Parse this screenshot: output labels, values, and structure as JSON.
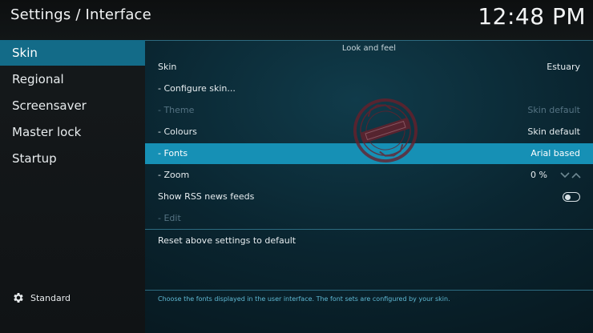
{
  "header": {
    "title": "Settings / Interface",
    "clock": "12:48 PM"
  },
  "sidebar": {
    "items": [
      {
        "label": "Skin",
        "active": true
      },
      {
        "label": "Regional",
        "active": false
      },
      {
        "label": "Screensaver",
        "active": false
      },
      {
        "label": "Master lock",
        "active": false
      },
      {
        "label": "Startup",
        "active": false
      }
    ],
    "level": {
      "icon": "gear-icon",
      "label": "Standard"
    }
  },
  "main": {
    "group_title": "Look and feel",
    "rows": [
      {
        "label": "Skin",
        "value": "Estuary",
        "state": "normal"
      },
      {
        "label": "- Configure skin...",
        "value": "",
        "state": "normal"
      },
      {
        "label": "- Theme",
        "value": "Skin default",
        "state": "disabled"
      },
      {
        "label": "- Colours",
        "value": "Skin default",
        "state": "normal"
      },
      {
        "label": "- Fonts",
        "value": "Arial based",
        "state": "focused"
      },
      {
        "label": "- Zoom",
        "value": "0 %",
        "state": "normal"
      },
      {
        "label": "Show RSS news feeds",
        "value": "",
        "state": "normal",
        "toggle": false
      },
      {
        "label": "- Edit",
        "value": "",
        "state": "disabled"
      }
    ],
    "reset_label": "Reset above settings to default",
    "help_text": "Choose the fonts displayed in the user interface. The font sets are configured by your skin."
  },
  "colors": {
    "accent_focus": "#1690b5",
    "accent_active": "#136b88",
    "disabled_text": "#557383",
    "help_text": "#5fb9d4"
  }
}
